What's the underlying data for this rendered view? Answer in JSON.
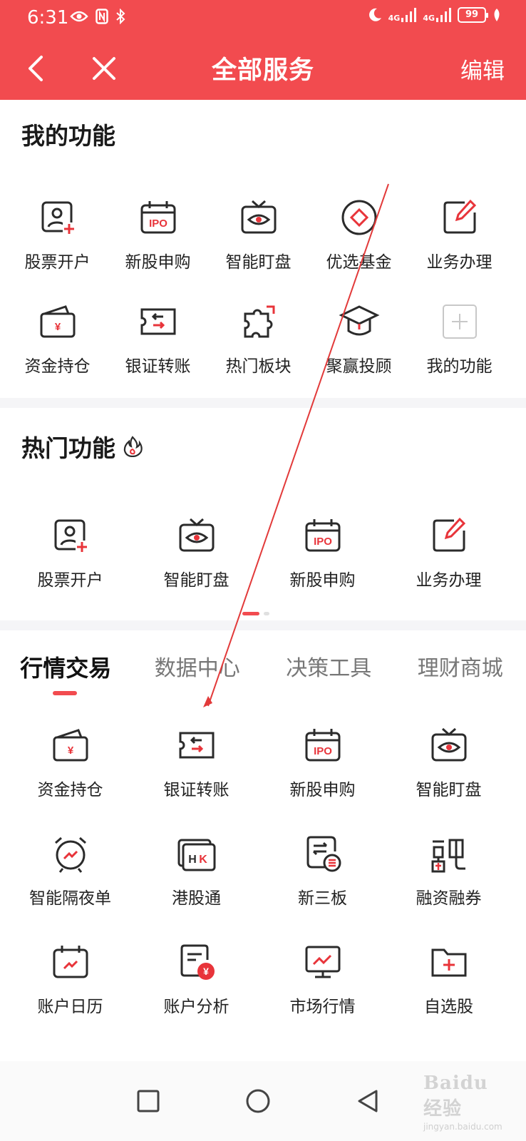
{
  "status": {
    "time": "6:31",
    "battery": "99",
    "net1": "4G",
    "net2": "4G"
  },
  "header": {
    "title": "全部服务",
    "edit": "编辑"
  },
  "my_functions": {
    "title": "我的功能",
    "items": [
      {
        "label": "股票开户",
        "icon": "account-open-icon"
      },
      {
        "label": "新股申购",
        "icon": "ipo-icon"
      },
      {
        "label": "智能盯盘",
        "icon": "watch-tv-icon"
      },
      {
        "label": "优选基金",
        "icon": "fund-icon"
      },
      {
        "label": "业务办理",
        "icon": "edit-business-icon"
      },
      {
        "label": "资金持仓",
        "icon": "wallet-icon"
      },
      {
        "label": "银证转账",
        "icon": "transfer-icon"
      },
      {
        "label": "热门板块",
        "icon": "puzzle-icon"
      },
      {
        "label": "聚赢投顾",
        "icon": "graduation-cap-icon"
      },
      {
        "label": "我的功能",
        "icon": "add-icon"
      }
    ]
  },
  "hot_functions": {
    "title": "热门功能",
    "items": [
      {
        "label": "股票开户",
        "icon": "account-open-icon"
      },
      {
        "label": "智能盯盘",
        "icon": "watch-tv-icon"
      },
      {
        "label": "新股申购",
        "icon": "ipo-icon"
      },
      {
        "label": "业务办理",
        "icon": "edit-business-icon"
      }
    ]
  },
  "category_tabs": [
    "行情交易",
    "数据中心",
    "决策工具",
    "理财商城"
  ],
  "trade_items": [
    {
      "label": "资金持仓",
      "icon": "wallet-icon"
    },
    {
      "label": "银证转账",
      "icon": "transfer-icon"
    },
    {
      "label": "新股申购",
      "icon": "ipo-icon"
    },
    {
      "label": "智能盯盘",
      "icon": "watch-tv-icon"
    },
    {
      "label": "智能隔夜单",
      "icon": "alarm-clock-icon"
    },
    {
      "label": "港股通",
      "icon": "hk-icon"
    },
    {
      "label": "新三板",
      "icon": "new-third-board-icon"
    },
    {
      "label": "融资融券",
      "icon": "margin-trading-icon"
    },
    {
      "label": "账户日历",
      "icon": "calendar-icon"
    },
    {
      "label": "账户分析",
      "icon": "account-analysis-icon"
    },
    {
      "label": "市场行情",
      "icon": "market-monitor-icon"
    },
    {
      "label": "自选股",
      "icon": "watchlist-folder-icon"
    }
  ],
  "icon_text": {
    "ipo": "IPO",
    "yen": "¥",
    "hk": "HK"
  },
  "watermark": {
    "main": "Baidu经验",
    "sub": "jingyan.baidu.com"
  },
  "colors": {
    "brand": "#f24b4f",
    "icon_stroke": "#2b2b2b",
    "accent": "#e8343a"
  }
}
